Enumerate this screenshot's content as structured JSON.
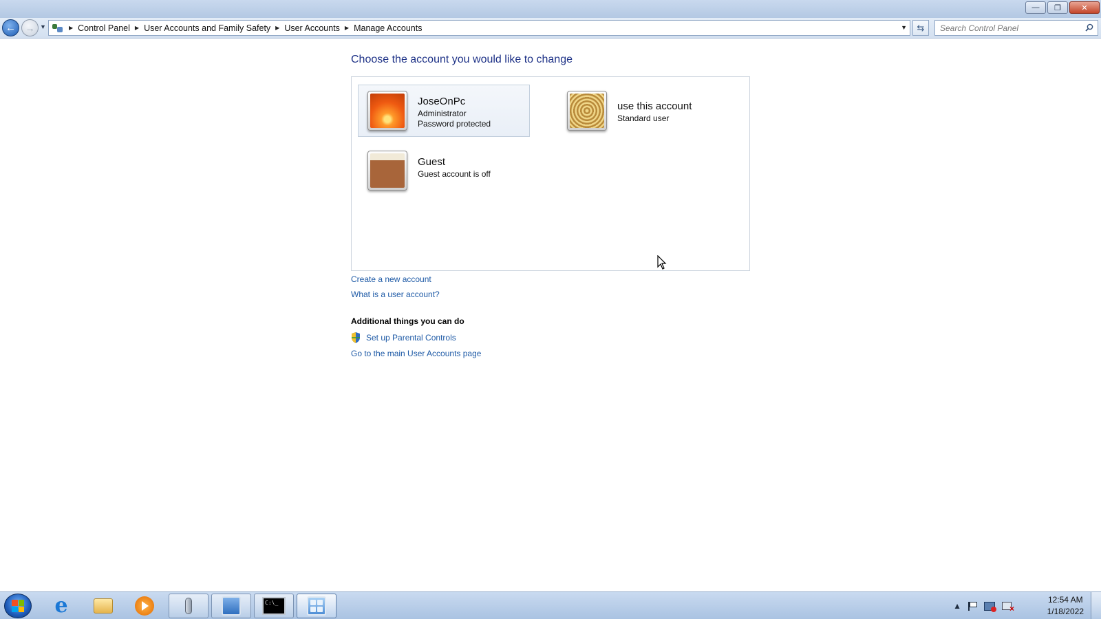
{
  "window": {
    "controls": {
      "minimize": "—",
      "restore": "❐",
      "close": "✕"
    }
  },
  "nav": {
    "back_icon": "back-arrow-icon",
    "forward_icon": "forward-arrow-icon"
  },
  "breadcrumb": [
    "Control Panel",
    "User Accounts and Family Safety",
    "User Accounts",
    "Manage Accounts"
  ],
  "search": {
    "placeholder": "Search Control Panel"
  },
  "main": {
    "title": "Choose the account you would like to change",
    "accounts": [
      {
        "name": "JoseOnPc",
        "type": "Administrator",
        "status": "Password protected",
        "picture": "orange-flower"
      },
      {
        "name": "use this account",
        "type": "Standard user",
        "picture": "seashell"
      },
      {
        "name": "Guest",
        "type": "Guest account is off",
        "picture": "briefcase"
      }
    ],
    "links": {
      "create": "Create a new account",
      "what_is": "What is a user account?"
    },
    "additional": {
      "heading": "Additional things you can do",
      "parental": "Set up Parental Controls",
      "main_page": "Go to the main User Accounts page"
    }
  },
  "taskbar": {
    "items": [
      "start-orb",
      "internet-explorer",
      "windows-explorer",
      "media-player",
      "speech-recognition",
      "remote-desktop",
      "command-prompt",
      "control-panel"
    ],
    "clock": {
      "time": "12:54 AM",
      "date": "1/18/2022"
    }
  },
  "colors": {
    "title": "#1e3287",
    "link": "#1e5aa6",
    "taskbar": "#aac3e2"
  }
}
